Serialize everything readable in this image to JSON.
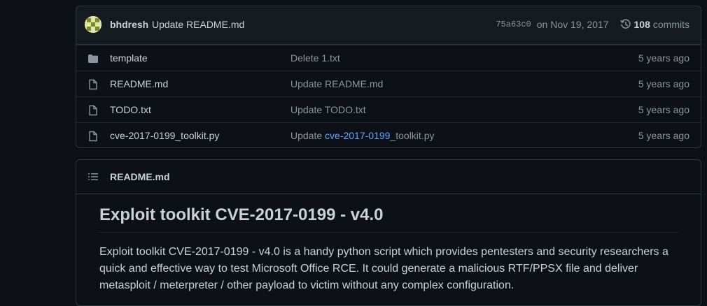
{
  "latest_commit": {
    "author": "bhdresh",
    "message": "Update README.md",
    "sha": "75a63c0",
    "date": "on Nov 19, 2017",
    "commit_count": "108",
    "commit_count_label": "commits"
  },
  "files": [
    {
      "name": "template",
      "type": "folder",
      "message": "Delete 1.txt",
      "age": "5 years ago"
    },
    {
      "name": "README.md",
      "type": "file",
      "message": "Update README.md",
      "age": "5 years ago"
    },
    {
      "name": "TODO.txt",
      "type": "file",
      "message": "Update TODO.txt",
      "age": "5 years ago"
    },
    {
      "name": "cve-2017-0199_toolkit.py",
      "type": "file",
      "message_prefix": "Update ",
      "message_link": "cve-2017-0199",
      "message_suffix": "_toolkit.py",
      "age": "5 years ago"
    }
  ],
  "readme": {
    "filename": "README.md",
    "heading": "Exploit toolkit CVE-2017-0199 - v4.0",
    "paragraph": "Exploit toolkit CVE-2017-0199 - v4.0 is a handy python script which provides pentesters and security researchers a quick and effective way to test Microsoft Office RCE. It could generate a malicious RTF/PPSX file and deliver metasploit / meterpreter / other payload to victim without any complex configuration."
  },
  "colors": {
    "background": "#0d1117",
    "link": "#58a6ff",
    "muted": "#8b949e",
    "border": "#30363d"
  },
  "icons": {
    "folder": "folder-icon",
    "file": "file-icon",
    "history": "history-icon",
    "list": "list-unordered-icon"
  }
}
